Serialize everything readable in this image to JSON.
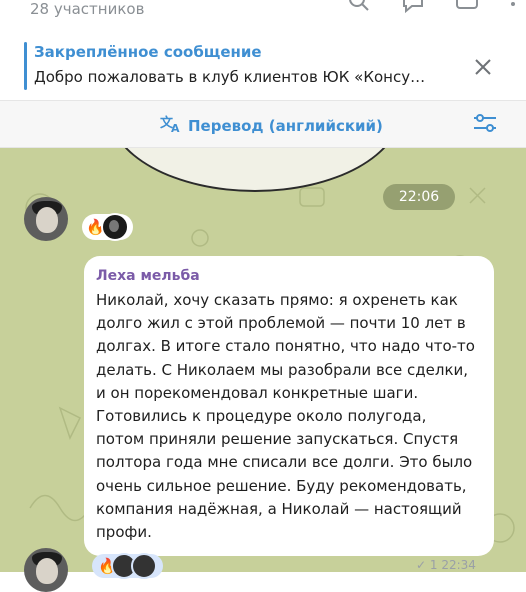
{
  "header": {
    "subtitle": "28 участников",
    "icons": [
      "search-icon",
      "chat-icon",
      "window-icon",
      "more-icon"
    ]
  },
  "pinned": {
    "title": "Закреплённое сообщение",
    "text": "Добро пожаловать в клуб клиентов ЮК «Консу…"
  },
  "translate": {
    "label": "Перевод (английский)"
  },
  "chat": {
    "time_divider": "22:06",
    "reaction1": {
      "emoji": "🔥"
    },
    "message": {
      "author": "Леха мельба",
      "text": "Николай, хочу сказать прямо: я охренеть как\nдолго жил с этой проблемой — почти 10 лет в\nдолгах. В итоге стало понятно, что надо что-то\nделать. С Николаем мы разобрали все сделки,\nи он порекомендовал конкретные шаги.\nГотовились к процедуре около полугода,\nпотом приняли решение запускаться. Спустя\nполтора года мне списали все долги. Это было\nочень сильное решение. Буду рекомендовать,\nкомпания надёжная, а Николай — настоящий\nпрофи.",
      "time": "✓ 1 22:34"
    },
    "reaction2": {
      "emoji": "🔥"
    }
  }
}
